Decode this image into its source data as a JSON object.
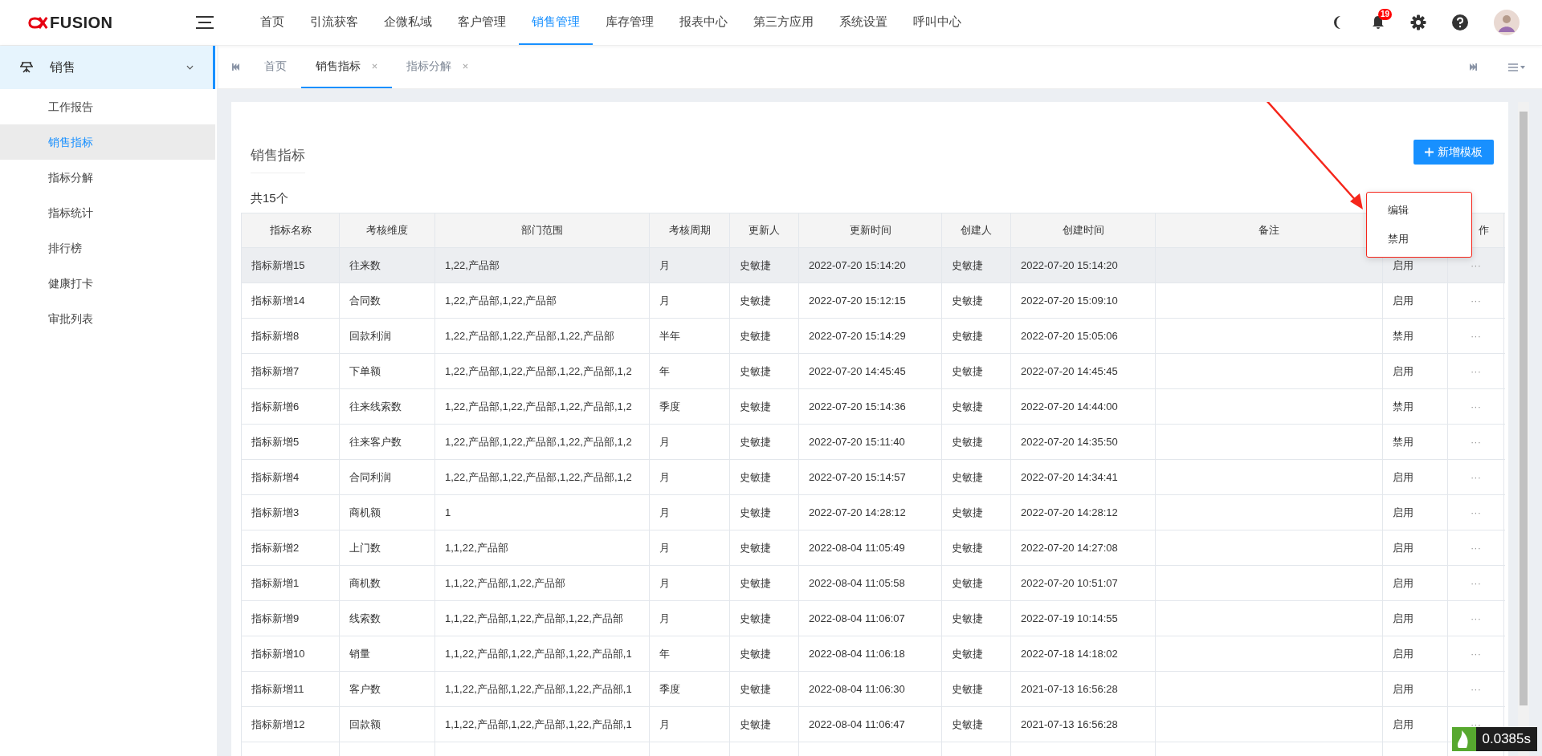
{
  "header": {
    "logo": "FUSION",
    "nav": [
      {
        "label": "首页",
        "selected": false
      },
      {
        "label": "引流获客",
        "selected": false
      },
      {
        "label": "企微私域",
        "selected": false
      },
      {
        "label": "客户管理",
        "selected": false
      },
      {
        "label": "销售管理",
        "selected": true
      },
      {
        "label": "库存管理",
        "selected": false
      },
      {
        "label": "报表中心",
        "selected": false
      },
      {
        "label": "第三方应用",
        "selected": false
      },
      {
        "label": "系统设置",
        "selected": false
      },
      {
        "label": "呼叫中心",
        "selected": false
      }
    ],
    "notification_count": "19"
  },
  "sidebar": {
    "group": {
      "label": "销售",
      "expanded": true,
      "items": [
        {
          "label": "工作报告",
          "selected": false
        },
        {
          "label": "销售指标",
          "selected": true
        },
        {
          "label": "指标分解",
          "selected": false
        },
        {
          "label": "指标统计",
          "selected": false
        },
        {
          "label": "排行榜",
          "selected": false
        },
        {
          "label": "健康打卡",
          "selected": false
        },
        {
          "label": "审批列表",
          "selected": false
        }
      ]
    }
  },
  "tabs": [
    {
      "label": "首页",
      "selected": false,
      "closable": false
    },
    {
      "label": "销售指标",
      "selected": true,
      "closable": true
    },
    {
      "label": "指标分解",
      "selected": false,
      "closable": true
    }
  ],
  "page": {
    "title": "销售指标",
    "add_button": "新增模板",
    "count": "共15个"
  },
  "table": {
    "columns": [
      "指标名称",
      "考核维度",
      "部门范围",
      "考核周期",
      "更新人",
      "更新时间",
      "创建人",
      "创建时间",
      "备注",
      "作"
    ],
    "rows": [
      {
        "name": "指标新增15",
        "dimension": "往来数",
        "departments": "1,22,产品部",
        "period": "月",
        "updated_by": "史敏捷",
        "updated_at": "2022-07-20 15:14:20",
        "created_by": "史敏捷",
        "created_at": "2022-07-20 15:14:20",
        "status": "启用",
        "actions": "···",
        "hovered": true
      },
      {
        "name": "指标新增14",
        "dimension": "合同数",
        "departments": "1,22,产品部,1,22,产品部",
        "period": "月",
        "updated_by": "史敏捷",
        "updated_at": "2022-07-20 15:12:15",
        "created_by": "史敏捷",
        "created_at": "2022-07-20 15:09:10",
        "status": "启用",
        "actions": "···",
        "hovered": false
      },
      {
        "name": "指标新增8",
        "dimension": "回款利润",
        "departments": "1,22,产品部,1,22,产品部,1,22,产品部",
        "period": "半年",
        "updated_by": "史敏捷",
        "updated_at": "2022-07-20 15:14:29",
        "created_by": "史敏捷",
        "created_at": "2022-07-20 15:05:06",
        "status": "禁用",
        "actions": "···",
        "hovered": false
      },
      {
        "name": "指标新增7",
        "dimension": "下单额",
        "departments": "1,22,产品部,1,22,产品部,1,22,产品部,1,2",
        "period": "年",
        "updated_by": "史敏捷",
        "updated_at": "2022-07-20 14:45:45",
        "created_by": "史敏捷",
        "created_at": "2022-07-20 14:45:45",
        "status": "启用",
        "actions": "···",
        "hovered": false
      },
      {
        "name": "指标新增6",
        "dimension": "往来线索数",
        "departments": "1,22,产品部,1,22,产品部,1,22,产品部,1,2",
        "period": "季度",
        "updated_by": "史敏捷",
        "updated_at": "2022-07-20 15:14:36",
        "created_by": "史敏捷",
        "created_at": "2022-07-20 14:44:00",
        "status": "禁用",
        "actions": "···",
        "hovered": false
      },
      {
        "name": "指标新增5",
        "dimension": "往来客户数",
        "departments": "1,22,产品部,1,22,产品部,1,22,产品部,1,2",
        "period": "月",
        "updated_by": "史敏捷",
        "updated_at": "2022-07-20 15:11:40",
        "created_by": "史敏捷",
        "created_at": "2022-07-20 14:35:50",
        "status": "禁用",
        "actions": "···",
        "hovered": false
      },
      {
        "name": "指标新增4",
        "dimension": "合同利润",
        "departments": "1,22,产品部,1,22,产品部,1,22,产品部,1,2",
        "period": "月",
        "updated_by": "史敏捷",
        "updated_at": "2022-07-20 15:14:57",
        "created_by": "史敏捷",
        "created_at": "2022-07-20 14:34:41",
        "status": "启用",
        "actions": "···",
        "hovered": false
      },
      {
        "name": "指标新增3",
        "dimension": "商机额",
        "departments": "1",
        "period": "月",
        "updated_by": "史敏捷",
        "updated_at": "2022-07-20 14:28:12",
        "created_by": "史敏捷",
        "created_at": "2022-07-20 14:28:12",
        "status": "启用",
        "actions": "···",
        "hovered": false
      },
      {
        "name": "指标新增2",
        "dimension": "上门数",
        "departments": "1,1,22,产品部",
        "period": "月",
        "updated_by": "史敏捷",
        "updated_at": "2022-08-04 11:05:49",
        "created_by": "史敏捷",
        "created_at": "2022-07-20 14:27:08",
        "status": "启用",
        "actions": "···",
        "hovered": false
      },
      {
        "name": "指标新增1",
        "dimension": "商机数",
        "departments": "1,1,22,产品部,1,22,产品部",
        "period": "月",
        "updated_by": "史敏捷",
        "updated_at": "2022-08-04 11:05:58",
        "created_by": "史敏捷",
        "created_at": "2022-07-20 10:51:07",
        "status": "启用",
        "actions": "···",
        "hovered": false
      },
      {
        "name": "指标新增9",
        "dimension": "线索数",
        "departments": "1,1,22,产品部,1,22,产品部,1,22,产品部",
        "period": "月",
        "updated_by": "史敏捷",
        "updated_at": "2022-08-04 11:06:07",
        "created_by": "史敏捷",
        "created_at": "2022-07-19 10:14:55",
        "status": "启用",
        "actions": "···",
        "hovered": false
      },
      {
        "name": "指标新增10",
        "dimension": "销量",
        "departments": "1,1,22,产品部,1,22,产品部,1,22,产品部,1",
        "period": "年",
        "updated_by": "史敏捷",
        "updated_at": "2022-08-04 11:06:18",
        "created_by": "史敏捷",
        "created_at": "2022-07-18 14:18:02",
        "status": "启用",
        "actions": "···",
        "hovered": false
      },
      {
        "name": "指标新增11",
        "dimension": "客户数",
        "departments": "1,1,22,产品部,1,22,产品部,1,22,产品部,1",
        "period": "季度",
        "updated_by": "史敏捷",
        "updated_at": "2022-08-04 11:06:30",
        "created_by": "史敏捷",
        "created_at": "2021-07-13 16:56:28",
        "status": "启用",
        "actions": "···",
        "hovered": false
      },
      {
        "name": "指标新增12",
        "dimension": "回款额",
        "departments": "1,1,22,产品部,1,22,产品部,1,22,产品部,1",
        "period": "月",
        "updated_by": "史敏捷",
        "updated_at": "2022-08-04 11:06:47",
        "created_by": "史敏捷",
        "created_at": "2021-07-13 16:56:28",
        "status": "启用",
        "actions": "···",
        "hovered": false
      }
    ]
  },
  "dropdown_menu": {
    "items": [
      "编辑",
      "禁用"
    ]
  },
  "timer_widget": {
    "reading": "0.0385s"
  }
}
